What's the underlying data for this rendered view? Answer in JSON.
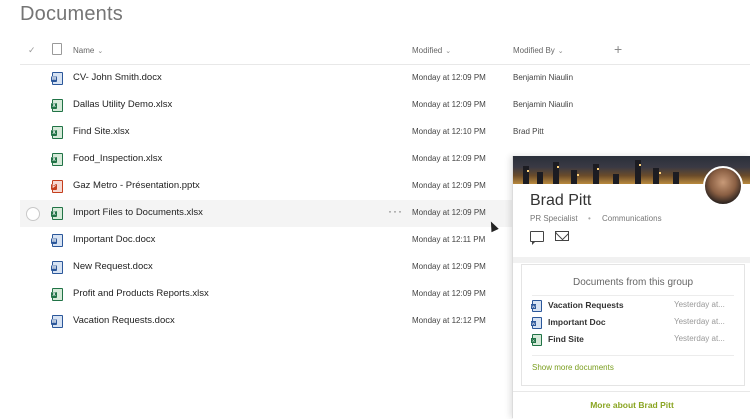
{
  "page": {
    "title": "Documents"
  },
  "header": {
    "name": "Name",
    "modified": "Modified",
    "modified_by": "Modified By",
    "add": "+"
  },
  "files": [
    {
      "name": "CV- John Smith.docx",
      "type": "docx",
      "modified": "Monday at 12:09 PM",
      "modified_by": "Benjamin Niaulin"
    },
    {
      "name": "Dallas Utility Demo.xlsx",
      "type": "xlsx",
      "modified": "Monday at 12:09 PM",
      "modified_by": "Benjamin Niaulin"
    },
    {
      "name": "Find Site.xlsx",
      "type": "xlsx",
      "modified": "Monday at 12:10 PM",
      "modified_by": "Brad Pitt"
    },
    {
      "name": "Food_Inspection.xlsx",
      "type": "xlsx",
      "modified": "Monday at 12:09 PM",
      "modified_by": ""
    },
    {
      "name": "Gaz Metro - Présentation.pptx",
      "type": "pptx",
      "modified": "Monday at 12:09 PM",
      "modified_by": ""
    },
    {
      "name": "Import Files to Documents.xlsx",
      "type": "xlsx",
      "modified": "Monday at 12:09 PM",
      "modified_by": ""
    },
    {
      "name": "Important Doc.docx",
      "type": "docx",
      "modified": "Monday at 12:11 PM",
      "modified_by": ""
    },
    {
      "name": "New Request.docx",
      "type": "docx",
      "modified": "Monday at 12:09 PM",
      "modified_by": ""
    },
    {
      "name": "Profit and Products Reports.xlsx",
      "type": "xlsx",
      "modified": "Monday at 12:09 PM",
      "modified_by": ""
    },
    {
      "name": "Vacation Requests.docx",
      "type": "docx",
      "modified": "Monday at 12:12 PM",
      "modified_by": ""
    }
  ],
  "selected_row_more": "···",
  "card": {
    "name": "Brad Pitt",
    "title": "PR Specialist",
    "department": "Communications",
    "group_title": "Documents from this group",
    "group_docs": [
      {
        "name": "Vacation Requests",
        "type": "docx",
        "time": "Yesterday at..."
      },
      {
        "name": "Important Doc",
        "type": "docx",
        "time": "Yesterday at..."
      },
      {
        "name": "Find Site",
        "type": "xlsx",
        "time": "Yesterday at..."
      }
    ],
    "show_more": "Show more documents",
    "more_about": "More about Brad Pitt"
  },
  "colors": {
    "word": "#2b579a",
    "excel": "#217346",
    "powerpoint": "#c43e1c",
    "accent_link": "#8aa522"
  }
}
